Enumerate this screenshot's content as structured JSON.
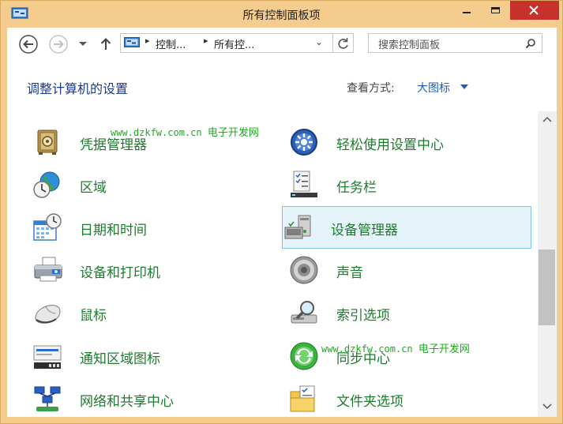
{
  "window": {
    "title": "所有控制面板项"
  },
  "nav": {
    "breadcrumbs": [
      "控制...",
      "所有控..."
    ],
    "search_placeholder": "搜索控制面板"
  },
  "header": {
    "page_title": "调整计算机的设置",
    "view_label": "查看方式:",
    "view_value": "大图标"
  },
  "items": [
    {
      "label": "凭据管理器",
      "icon": "credential-vault-icon"
    },
    {
      "label": "轻松使用设置中心",
      "icon": "ease-of-access-icon"
    },
    {
      "label": "区域",
      "icon": "region-clock-globe-icon"
    },
    {
      "label": "任务栏",
      "icon": "taskbar-checklist-icon"
    },
    {
      "label": "日期和时间",
      "icon": "calendar-clock-icon"
    },
    {
      "label": "设备管理器",
      "icon": "device-manager-icon"
    },
    {
      "label": "设备和打印机",
      "icon": "printer-icon"
    },
    {
      "label": "声音",
      "icon": "speaker-icon"
    },
    {
      "label": "鼠标",
      "icon": "mouse-icon"
    },
    {
      "label": "索引选项",
      "icon": "index-search-icon"
    },
    {
      "label": "通知区域图标",
      "icon": "notification-area-icon"
    },
    {
      "label": "同步中心",
      "icon": "sync-center-icon"
    },
    {
      "label": "网络和共享中心",
      "icon": "network-sharing-icon"
    },
    {
      "label": "文件夹选项",
      "icon": "folder-options-icon"
    }
  ],
  "selected_item": "设备管理器",
  "watermarks": [
    {
      "url": "www.dzkfw.com.cn",
      "name": "电子开发网"
    },
    {
      "url": "www.dzkfw.com.cn",
      "name": "电子开发网"
    }
  ],
  "colors": {
    "titlebar": "#f3cc8e",
    "close": "#c7312b",
    "link": "#1c5ec4",
    "item_text": "#1e7b2e",
    "title_text": "#1e3a8a"
  }
}
